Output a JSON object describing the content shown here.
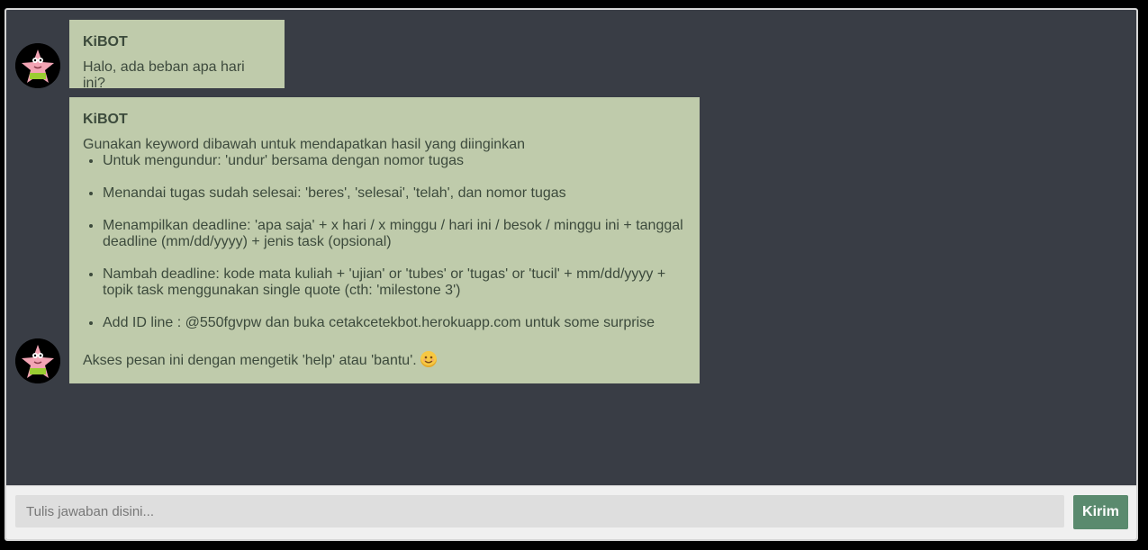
{
  "chat": {
    "messages": [
      {
        "sender": "KiBOT",
        "text": "Halo, ada beban apa hari ini?"
      },
      {
        "sender": "KiBOT",
        "intro": "Gunakan keyword dibawah untuk mendapatkan hasil yang diinginkan",
        "items": [
          "Untuk mengundur: 'undur' bersama dengan nomor tugas",
          "Menandai tugas sudah selesai: 'beres', 'selesai', 'telah', dan nomor tugas",
          "Menampilkan deadline: 'apa saja' + x hari / x minggu / hari ini / besok / minggu ini + tanggal deadline (mm/dd/yyyy) + jenis task (opsional)",
          "Nambah deadline: kode mata kuliah + 'ujian' or 'tubes' or 'tugas' or 'tucil' + mm/dd/yyyy + topik task menggunakan single quote (cth: 'milestone 3')",
          "Add ID line : @550fgvpw dan buka cetakcetekbot.herokuapp.com untuk some surprise"
        ],
        "footer": "Akses pesan ini dengan mengetik 'help' atau 'bantu'."
      }
    ]
  },
  "input": {
    "placeholder": "Tulis jawaban disini...",
    "send_label": "Kirim"
  },
  "colors": {
    "background": "#393d45",
    "bubble": "#bfcbab",
    "send_button": "#5a8a6e"
  },
  "icons": {
    "avatar": "patrick-star-avatar",
    "emoji": "smiling-face-emoji"
  }
}
